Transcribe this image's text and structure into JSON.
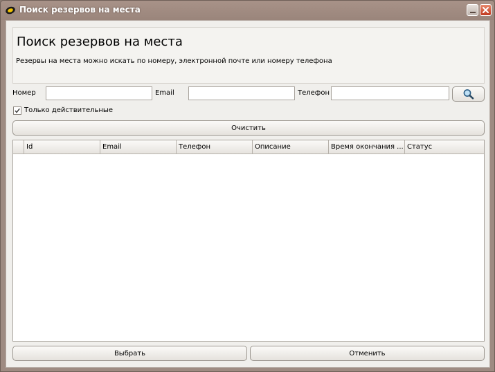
{
  "window": {
    "title": "Поиск резервов на места"
  },
  "header": {
    "title": "Поиск резервов на места",
    "subtitle": "Резервы на места можно искать по номеру, электронной почте или номеру телефона"
  },
  "search": {
    "number_label": "Номер",
    "number_value": "",
    "email_label": "Email",
    "email_value": "",
    "phone_label": "Телефон",
    "phone_value": ""
  },
  "filter": {
    "only_valid_label": "Только действительные",
    "only_valid_checked": true
  },
  "clear_label": "Очистить",
  "table": {
    "columns": [
      "Id",
      "Email",
      "Телефон",
      "Описание",
      "Время окончания ...",
      "Статус"
    ],
    "rows": []
  },
  "footer": {
    "select_label": "Выбрать",
    "cancel_label": "Отменить"
  }
}
